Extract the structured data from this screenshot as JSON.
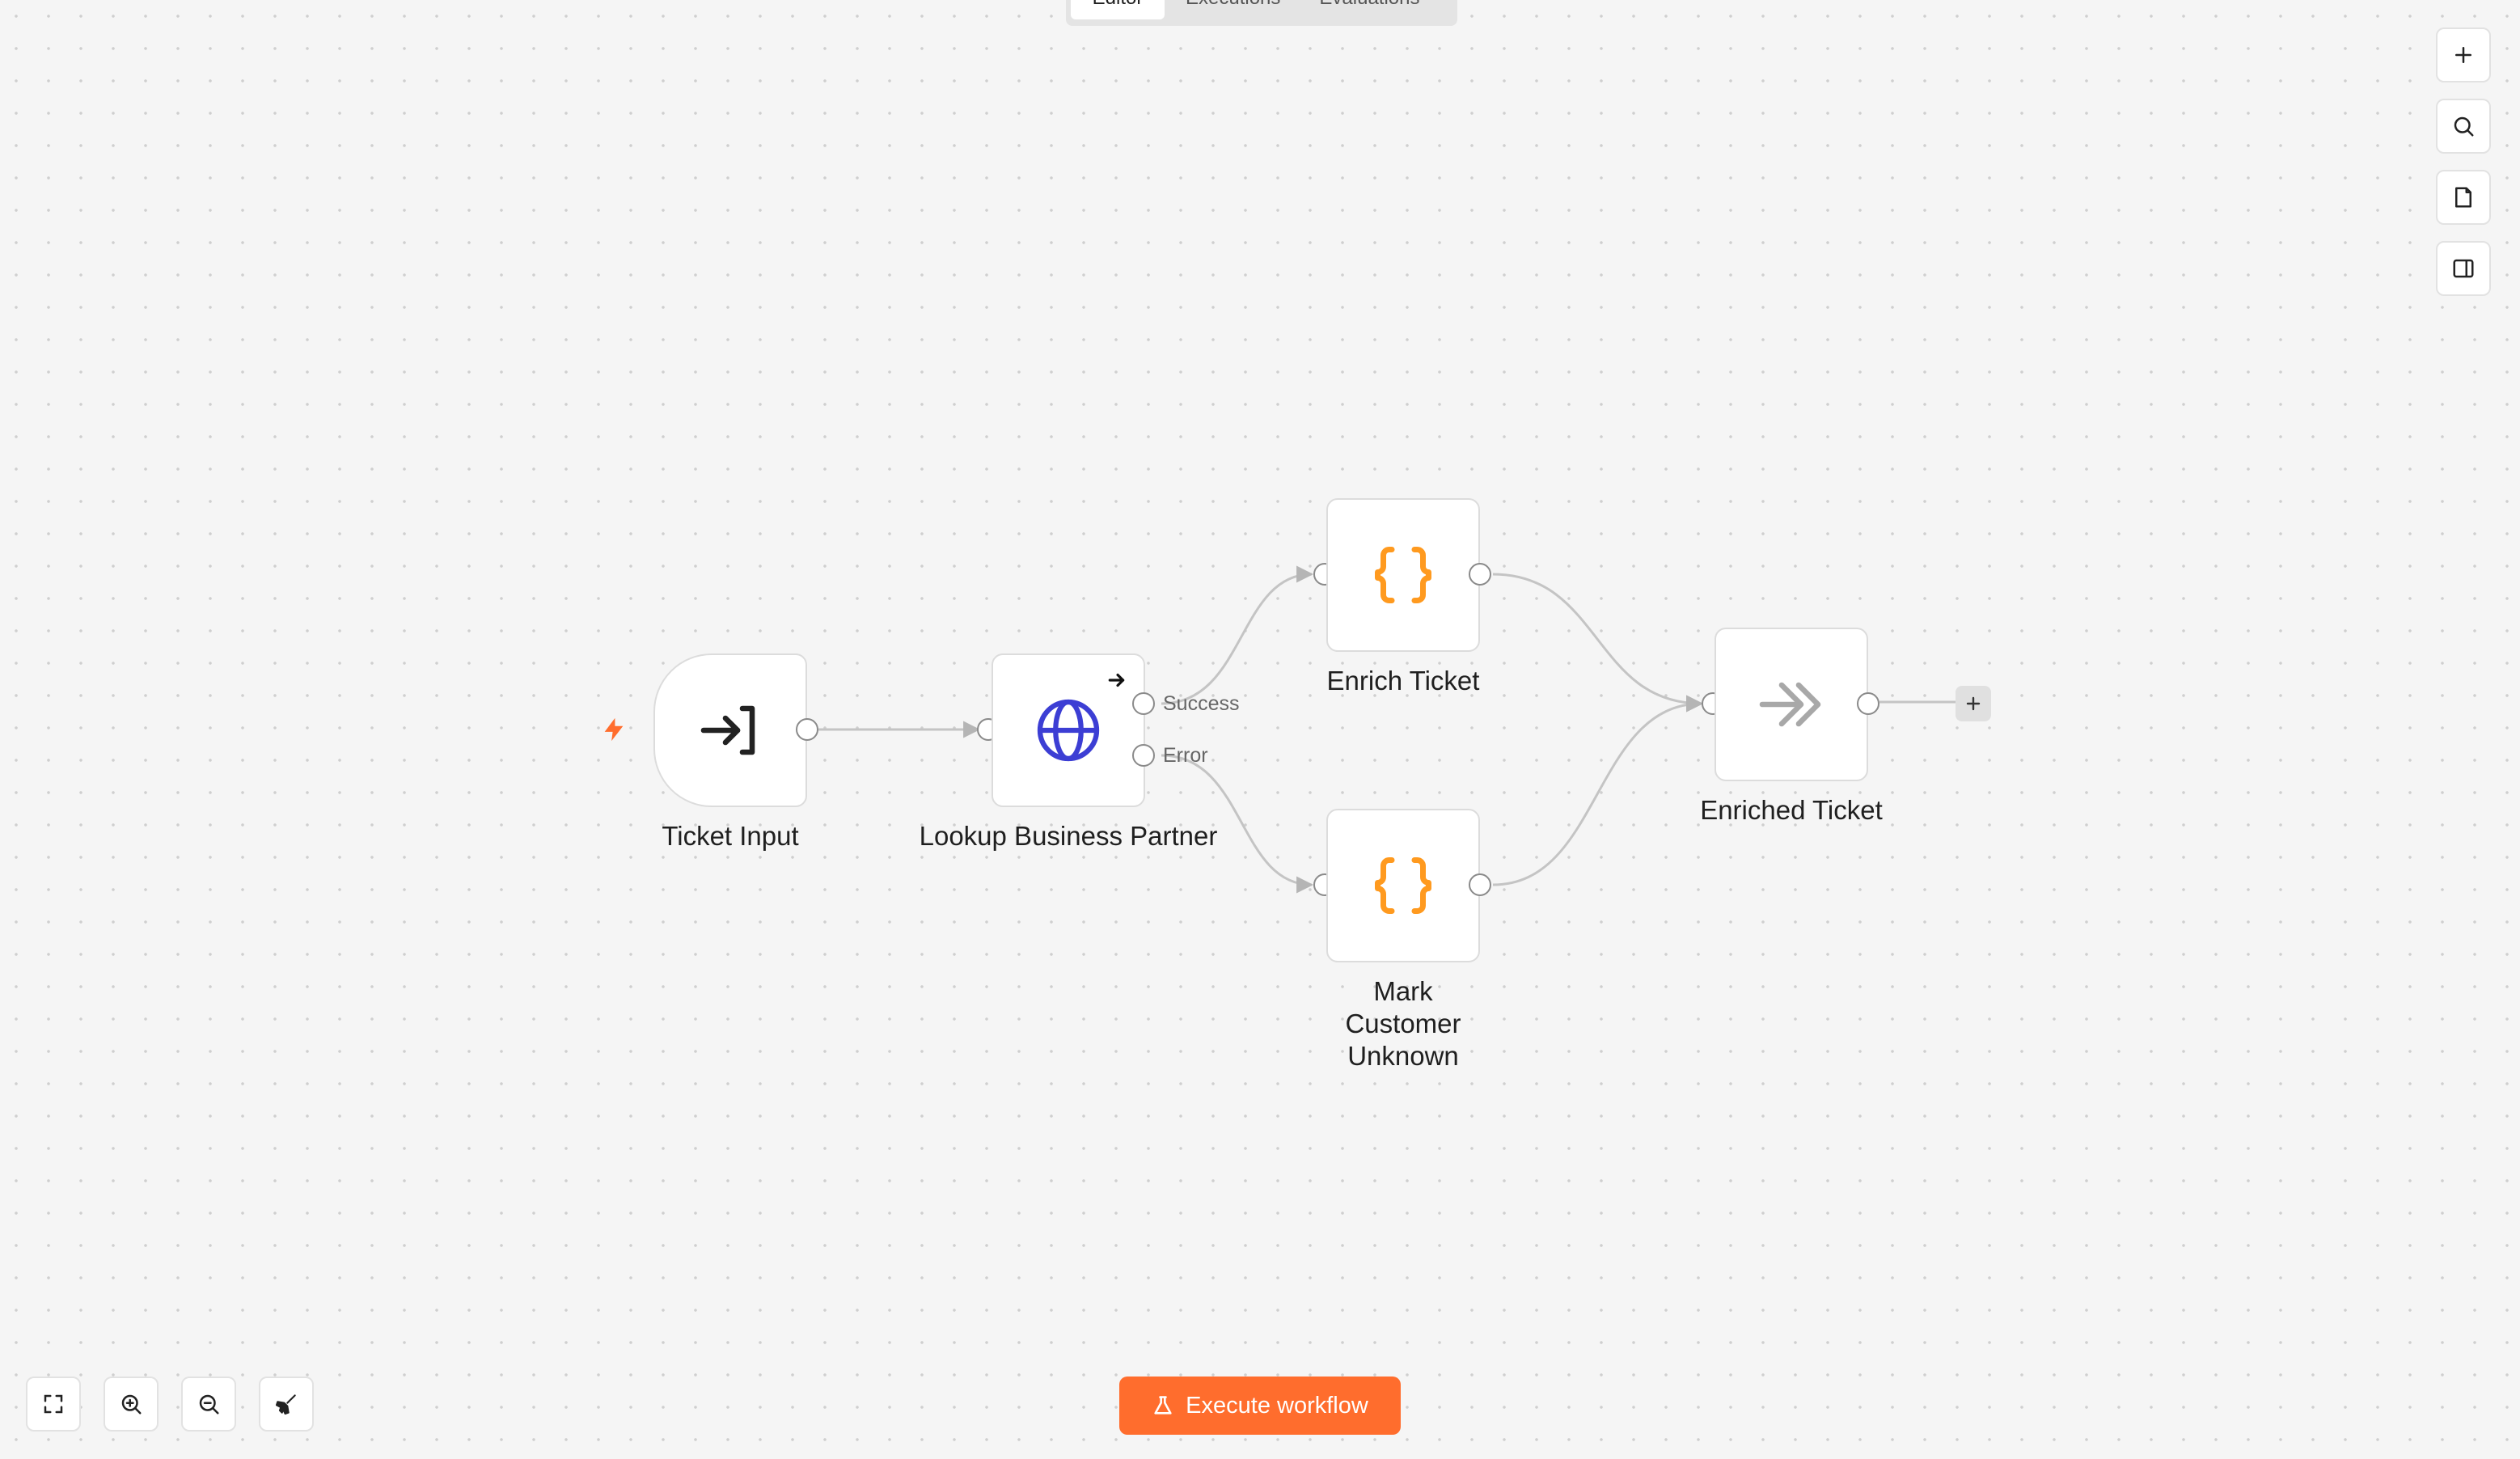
{
  "header": {
    "tabs": [
      {
        "label": "Editor",
        "active": true
      },
      {
        "label": "Executions",
        "active": false
      },
      {
        "label": "Evaluations",
        "active": false
      }
    ]
  },
  "canvas": {
    "nodes": [
      {
        "label": "Ticket Input",
        "icon": "sign-in-arrow-icon"
      },
      {
        "label": "Lookup Business Partner",
        "icon": "globe-icon"
      },
      {
        "label": "Enrich Ticket",
        "icon": "curly-braces-icon"
      },
      {
        "label": "Mark Customer Unknown",
        "icon": "curly-braces-icon"
      },
      {
        "label": "Enriched Ticket",
        "icon": "double-chevron-right-icon"
      }
    ],
    "outputs": {
      "success": "Success",
      "error": "Error"
    }
  },
  "footer": {
    "execute_label": "Execute workflow"
  },
  "colors": {
    "accent": "#ff6d2d",
    "http_icon": "#3c3ed4",
    "code_icon": "#ff9a1f",
    "canvas_bg": "#f5f5f5"
  }
}
